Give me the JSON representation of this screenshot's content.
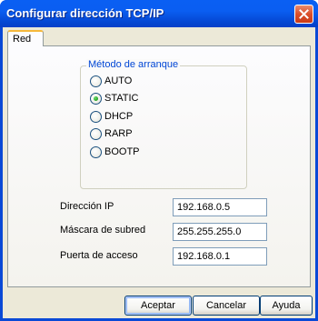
{
  "window": {
    "title": "Configurar dirección TCP/IP",
    "close_icon": "close-icon"
  },
  "tabs": [
    {
      "label": "Red",
      "active": true
    }
  ],
  "boot_method": {
    "legend": "Método de arranque",
    "selected": "STATIC",
    "options": [
      {
        "label": "AUTO",
        "checked": false
      },
      {
        "label": "STATIC",
        "checked": true
      },
      {
        "label": "DHCP",
        "checked": false
      },
      {
        "label": "RARP",
        "checked": false
      },
      {
        "label": "BOOTP",
        "checked": false
      }
    ]
  },
  "fields": {
    "ip": {
      "label": "Dirección IP",
      "value": "192.168.0.5"
    },
    "subnet": {
      "label": "Máscara de subred",
      "value": "255.255.255.0"
    },
    "gateway": {
      "label": "Puerta de acceso",
      "value": "192.168.0.1"
    }
  },
  "buttons": {
    "ok": "Aceptar",
    "cancel": "Cancelar",
    "help": "Ayuda"
  },
  "colors": {
    "titlebar": "#0a5ef1",
    "dialog_face": "#ece9d8",
    "legend_text": "#0046d5",
    "radio_selected": "#21a121",
    "close_button": "#db4f2b"
  }
}
